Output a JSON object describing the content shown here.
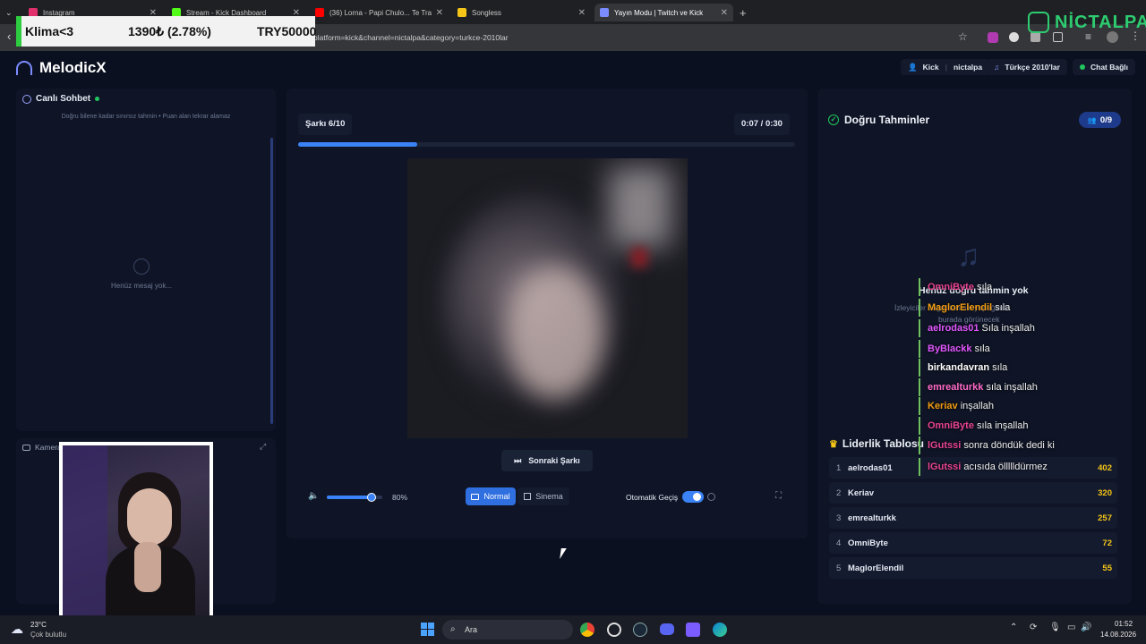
{
  "browser": {
    "tabs": [
      {
        "label": "Instagram",
        "color": "#e1306c"
      },
      {
        "label": "Stream - Kick Dashboard",
        "color": "#53fc18"
      },
      {
        "label": "(36) Lorna - Papi Chulo... Te Tra",
        "color": "#ff0000"
      },
      {
        "label": "Songless",
        "color": "#f5c518"
      },
      {
        "label": "Yayın Modu | Twitch ve Kick",
        "color": "#7a8cff"
      }
    ],
    "url": "platform=kick&channel=nictalpa&category=turkce-2010lar",
    "new_tab": "+"
  },
  "ticker": {
    "name": "Klima<3",
    "value": "1390₺ (2.78%)",
    "goal": "TRY50000"
  },
  "streamer_logo": "NİCTALPA",
  "app": {
    "title": "MelodicX",
    "platform_label": "Kick",
    "channel": "nictalpa",
    "category": "Türkçe 2010'lar",
    "chat_status": "Chat Bağlı"
  },
  "chat_panel": {
    "title": "Canlı Sohbet",
    "hint": "Doğru bilene kadar sınırsız tahmin • Puan alan tekrar alamaz",
    "empty": "Henüz mesaj yok..."
  },
  "camera_panel": {
    "title": "Kamera"
  },
  "player": {
    "song_counter": "Şarkı 6/10",
    "time_current": "0:07",
    "time_total": "0:30",
    "progress": 0.24,
    "next_label": "Sonraki Şarkı",
    "volume_percent": "80%",
    "volume": 0.8,
    "mode_normal": "Normal",
    "mode_cinema": "Sinema",
    "auto_label": "Otomatik Geçiş"
  },
  "guesses": {
    "title": "Doğru Tahminler",
    "count": "0/9",
    "empty_title": "Henüz doğru tahmin yok",
    "empty_sub_1": "İzleyiciler doğru tahmin yaptığında",
    "empty_sub_2": "burada görünecek"
  },
  "leaderboard": {
    "title": "Liderlik Tablosu",
    "rows": [
      {
        "rank": "1",
        "user": "aelrodas01",
        "score": "402"
      },
      {
        "rank": "2",
        "user": "Keriav",
        "score": "320"
      },
      {
        "rank": "3",
        "user": "emrealturkk",
        "score": "257"
      },
      {
        "rank": "4",
        "user": "OmniByte",
        "score": "72"
      },
      {
        "rank": "5",
        "user": "MaglorElendil",
        "score": "55"
      }
    ]
  },
  "chat_overlay": [
    {
      "user": "OmniByte",
      "msg": "sıla",
      "color": "#e84393"
    },
    {
      "user": "MaglorElendil",
      "msg": "sıla",
      "color": "#f39c12"
    },
    {
      "user": "aelrodas01",
      "msg": "Sıla inşallah",
      "color": "#e056fd"
    },
    {
      "user": "ByBlackk",
      "msg": "sıla",
      "color": "#e056fd"
    },
    {
      "user": "birkandavran",
      "msg": "sıla",
      "color": "#ffffff"
    },
    {
      "user": "emrealturkk",
      "msg": "sıla inşallah",
      "color": "#ff6bcb"
    },
    {
      "user": "Keriav",
      "msg": "inşallah",
      "color": "#f39c12"
    },
    {
      "user": "OmniByte",
      "msg": "sıla inşallah",
      "color": "#e84393"
    },
    {
      "user": "lGutssi",
      "msg": "sonra döndük dedi ki",
      "color": "#e84393"
    },
    {
      "user": "lGutssi",
      "msg": "acısıda öllllldürmez",
      "color": "#e84393"
    }
  ],
  "taskbar": {
    "temp": "23°C",
    "weather": "Çok bulutlu",
    "search": "Ara",
    "time": "01:52",
    "date": "14.08.2026"
  },
  "colors": {
    "accent": "#3b82f6",
    "bg": "#0b1020",
    "gold": "#f5c518",
    "green": "#22c55e"
  }
}
